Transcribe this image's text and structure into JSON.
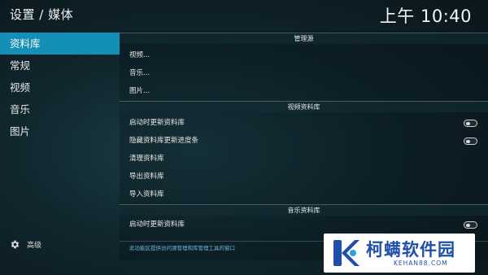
{
  "header": {
    "title": "设置 / 媒体",
    "clock": "上午 10:40"
  },
  "sidebar": {
    "items": [
      {
        "label": "资料库",
        "active": true
      },
      {
        "label": "常规",
        "active": false
      },
      {
        "label": "视频",
        "active": false
      },
      {
        "label": "音乐",
        "active": false
      },
      {
        "label": "图片",
        "active": false
      }
    ],
    "footer_label": "高级",
    "footer_icon": "gear-icon"
  },
  "main": {
    "sections": {
      "manage_sources": {
        "title": "管理源",
        "items": [
          "视频...",
          "音乐...",
          "图片..."
        ]
      },
      "video_library": {
        "title": "视频资料库",
        "items": [
          {
            "label": "启动时更新资料库",
            "toggle": false
          },
          {
            "label": "隐藏资料库更新进度条",
            "toggle": false
          },
          {
            "label": "清理资料库"
          },
          {
            "label": "导出资料库"
          },
          {
            "label": "导入资料库"
          }
        ]
      },
      "music_library": {
        "title": "音乐资料库",
        "items": [
          {
            "label": "启动时更新资料库",
            "toggle": false
          }
        ]
      }
    },
    "hint": "此功能区提供访问源管理和库管理工具的窗口"
  },
  "watermark": {
    "main": "柯螨软件园",
    "sub": "KEHAN88.COM"
  },
  "colors": {
    "accent": "#1490b6",
    "hint": "#6fb8d4",
    "logo": "#1f4fa8"
  }
}
